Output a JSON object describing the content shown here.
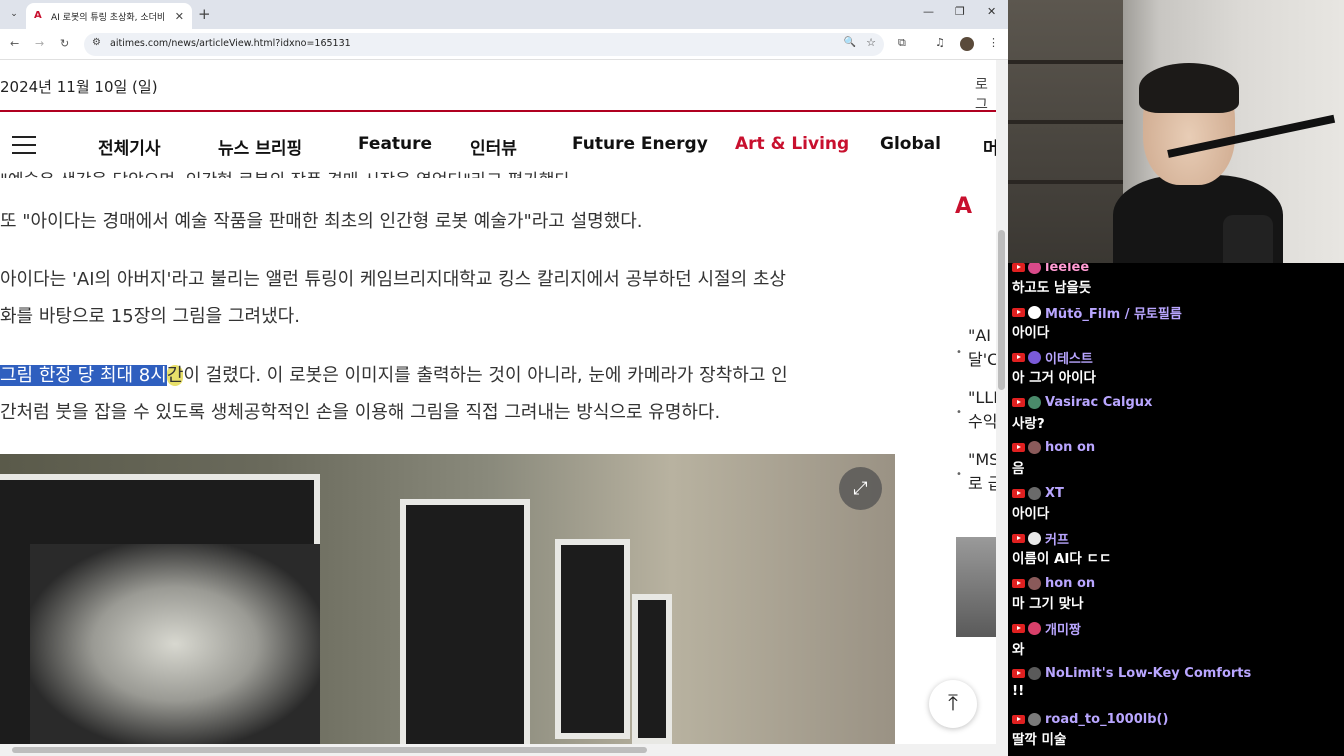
{
  "browser": {
    "tab_title": "AI 로봇의 튜링 초상화, 소더비",
    "url": "aitimes.com/news/articleView.html?idxno=165131"
  },
  "site": {
    "date": "2024년 11월 10일 (일)",
    "login": "로그",
    "menu": [
      "전체기사",
      "뉴스 브리핑",
      "Feature",
      "인터뷰",
      "Future Energy",
      "Art & Living",
      "Global",
      "머"
    ],
    "highlight_menu": "Art & Living"
  },
  "article": {
    "prev_line": "\"예술은 생각을 담았으며, 인간형 로봇의 작품 경매 시장을 열었다\"라고 평가했다.",
    "para1": "또 \"아이다는 경매에서 예술 작품을 판매한 최초의 인간형 로봇 예술가\"라고 설명했다.",
    "para2_line1": "아이다는 'AI의 아버지'라고 불리는 앨런 튜링이 케임브리지대학교 킹스 칼리지에서 공부하던 시절의 초상",
    "para2_line2": "화를 바탕으로 15장의 그림을 그려냈다.",
    "para3_selected": "그림 한장 당 최대 8시",
    "para3_highlight": "간",
    "para3_rest": "이 걸렸다. 이 로봇은 이미지를 출력하는 것이 아니라, 눈에 카메라가 장착하고 인",
    "para3_line2": "간처럼 붓을 잡을 수 있도록 생체공학적인 손을 이용해 그림을 직접 그려내는 방식으로 유명하다."
  },
  "sidebar": {
    "items": [
      "\"AI '",
      "달'C",
      "\"LLI",
      "수익",
      "\"MS",
      "로 급"
    ]
  },
  "chat": [
    {
      "nick": "leelee",
      "text": "하고도 남을듯",
      "color": "#ff9bd2",
      "avatar": "#d94a8a"
    },
    {
      "nick": "Mūtō_Film / 뮤토필름",
      "text": "아이다",
      "color": "#b9a6ff",
      "avatar": "#ffffff"
    },
    {
      "nick": "이테스트",
      "text": "아 그거 아이다",
      "color": "#b9a6ff",
      "avatar": "#7a5ad8"
    },
    {
      "nick": "Vasirac Calgux",
      "text": "사랑?",
      "color": "#b9a6ff",
      "avatar": "#4a8a6a"
    },
    {
      "nick": "hon on",
      "text": "음",
      "color": "#b9a6ff",
      "avatar": "#8a5a5a"
    },
    {
      "nick": "XT",
      "text": "아이다",
      "color": "#b9a6ff",
      "avatar": "#6a6a6a"
    },
    {
      "nick": "커프",
      "text": "이름이 AI다 ㄷㄷ",
      "color": "#b9a6ff",
      "avatar": "#e8e8e8"
    },
    {
      "nick": "hon on",
      "text": "마 그기 맞나",
      "color": "#b9a6ff",
      "avatar": "#8a5a5a"
    },
    {
      "nick": "개미짱",
      "text": "와",
      "color": "#b9a6ff",
      "avatar": "#d8406a"
    },
    {
      "nick": "NoLimit's Low-Key Comforts",
      "text": "!!",
      "color": "#b9a6ff",
      "avatar": "#5a5a5a"
    },
    {
      "nick": "road_to_1000lb()",
      "text": "딸깍 미술",
      "color": "#b9a6ff",
      "avatar": "#7a7a7a"
    }
  ]
}
